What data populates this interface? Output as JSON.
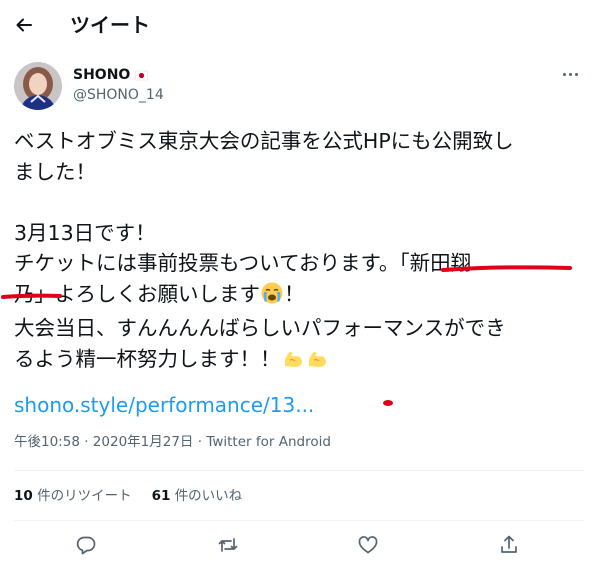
{
  "header": {
    "title": "ツイート",
    "back_icon": "arrow-left-icon"
  },
  "author": {
    "name": "SHONO",
    "name_flag": "japan-flag-icon",
    "handle": "@SHONO_14"
  },
  "tweet": {
    "lines": [
      "ベストオブミス東京大会の記事を公式HPにも公開致し",
      "ました！",
      "",
      "3月13日です！",
      "チケットには事前投票もついております。「新田翔",
      "乃」よろしくお願いします",
      "！",
      "大会当日、すんんんんばらしいパフォーマンスができ",
      "るよう精一杯努力します！！"
    ],
    "link": "shono.style/performance/13..."
  },
  "meta": {
    "time": "午後10:58",
    "date": "2020年1月27日",
    "source": "Twitter for Android",
    "sep": "·"
  },
  "stats": {
    "retweets_count": "10",
    "retweets_label": "件のリツイート",
    "likes_count": "61",
    "likes_label": "件のいいね"
  },
  "actions": [
    "reply-icon",
    "retweet-icon",
    "like-icon",
    "share-icon"
  ],
  "colors": {
    "link": "#1d9bf0",
    "secondary": "#536471",
    "annotation": "#e0001a",
    "flag": "#bc002d"
  }
}
